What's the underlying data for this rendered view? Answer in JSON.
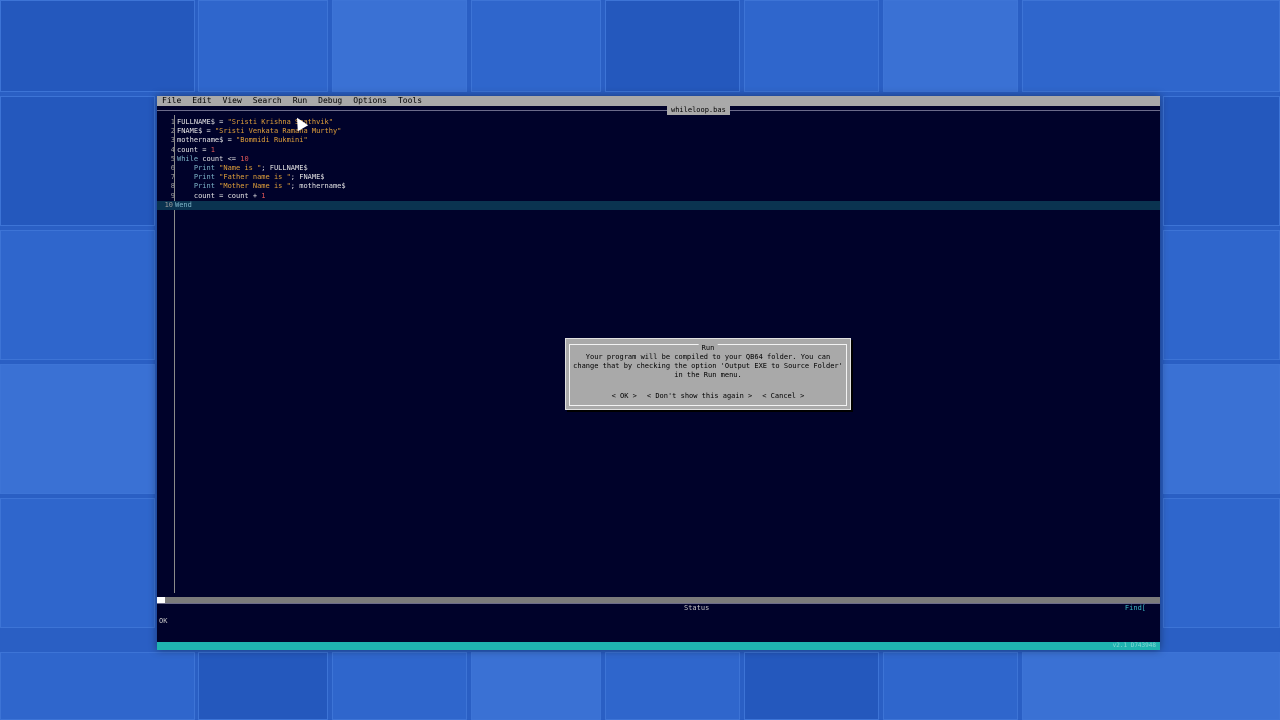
{
  "menu": [
    "File",
    "Edit",
    "View",
    "Search",
    "Run",
    "Debug",
    "Options",
    "Tools"
  ],
  "file_tab": "whileloop.bas",
  "code_lines": [
    {
      "n": "1",
      "parts": [
        [
          "v",
          "FULLNAME$"
        ],
        [
          "v",
          " = "
        ],
        [
          "s",
          "\"Sristi Krishna Saathvik\""
        ]
      ]
    },
    {
      "n": "2",
      "parts": [
        [
          "v",
          "FNAME$"
        ],
        [
          "v",
          " = "
        ],
        [
          "s",
          "\"Sristi Venkata Ramana Murthy\""
        ]
      ]
    },
    {
      "n": "3",
      "parts": [
        [
          "v",
          "mothername$"
        ],
        [
          "v",
          " = "
        ],
        [
          "s",
          "\"Bommidi Rukmini\""
        ]
      ]
    },
    {
      "n": "4",
      "parts": [
        [
          "v",
          "count"
        ],
        [
          "v",
          " = "
        ],
        [
          "n",
          "1"
        ]
      ]
    },
    {
      "n": "5",
      "parts": [
        [
          "k",
          "While"
        ],
        [
          "v",
          " count <= "
        ],
        [
          "n",
          "10"
        ]
      ]
    },
    {
      "n": "6",
      "parts": [
        [
          "v",
          "    "
        ],
        [
          "k",
          "Print"
        ],
        [
          "s",
          " \"Name is \""
        ],
        [
          "v",
          "; FULLNAME$"
        ]
      ]
    },
    {
      "n": "7",
      "parts": [
        [
          "v",
          "    "
        ],
        [
          "k",
          "Print"
        ],
        [
          "s",
          " \"Father name is \""
        ],
        [
          "v",
          "; FNAME$"
        ]
      ]
    },
    {
      "n": "8",
      "parts": [
        [
          "v",
          "    "
        ],
        [
          "k",
          "Print"
        ],
        [
          "s",
          " \"Mother Name is \""
        ],
        [
          "v",
          "; mothername$"
        ]
      ]
    },
    {
      "n": "9",
      "parts": [
        [
          "v",
          "    count = count + "
        ],
        [
          "n",
          "1"
        ]
      ]
    },
    {
      "n": "10",
      "parts": [
        [
          "k",
          "Wend"
        ]
      ]
    }
  ],
  "dialog": {
    "title": "Run",
    "message": "Your program will be compiled to your QB64 folder. You can change that by checking the option 'Output EXE to Source Folder' in the Run menu.",
    "buttons": [
      "< OK >",
      "< Don't show this again >",
      "< Cancel >"
    ]
  },
  "status": {
    "title": "Status",
    "find": "Find[",
    "text": "OK",
    "version": "v2.1 D743948"
  },
  "colors": {
    "editor_bg": "#00022a",
    "menubar": "#a9a9a9",
    "bottom_bar": "#1fb3b0",
    "string": "#e2a23a",
    "keyword": "#7db4c8"
  }
}
